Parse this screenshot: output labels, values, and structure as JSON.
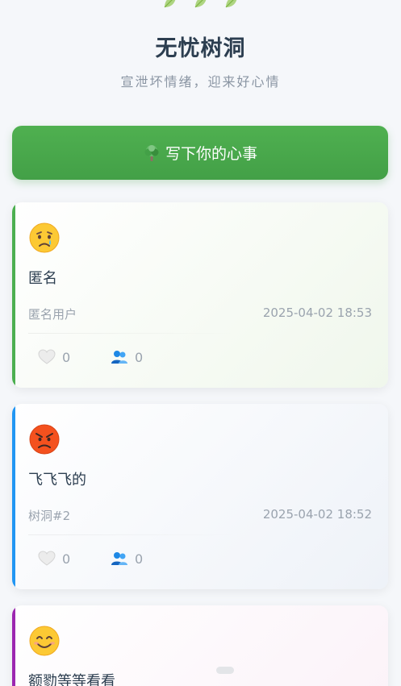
{
  "header": {
    "title": "无忧树洞",
    "subtitle": "宣泄坏情绪，迎来好心情",
    "decoration_icon": "leaf-icon"
  },
  "write_button": {
    "icon": "tree-icon",
    "label": "写下你的心事"
  },
  "posts": [
    {
      "emoji": "crying-face",
      "text": "匿名",
      "author": "匿名用户",
      "time": "2025-04-02 18:53",
      "likes": "0",
      "hugs": "0",
      "accent": "#4caf50"
    },
    {
      "emoji": "angry-face",
      "text": "飞飞飞的",
      "author": "树洞#2",
      "time": "2025-04-02 18:52",
      "likes": "0",
      "hugs": "0",
      "accent": "#2196f3"
    },
    {
      "emoji": "smiling-face",
      "text": "额勠等等看看",
      "accent": "#9c27b0"
    }
  ],
  "colors": {
    "primary": "#4caf50",
    "background": "#f5f7fa"
  }
}
